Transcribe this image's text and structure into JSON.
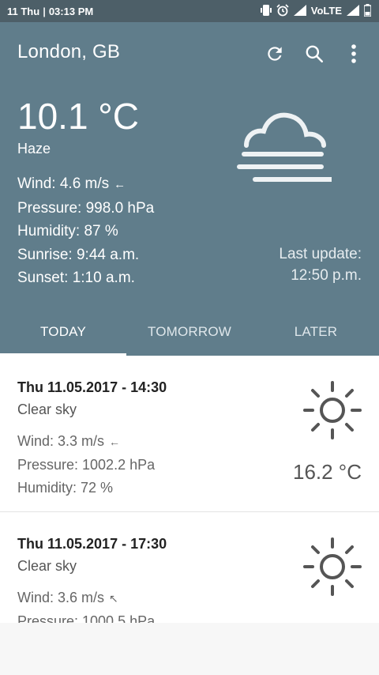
{
  "status_bar": {
    "date": "11 Thu",
    "time": "03:13 PM",
    "network": "VoLTE"
  },
  "header": {
    "city": "London, GB",
    "temperature": "10.1 °C",
    "description": "Haze",
    "wind": "Wind: 4.6 m/s",
    "wind_arrow": "←",
    "pressure": "Pressure: 998.0 hPa",
    "humidity": "Humidity: 87 %",
    "sunrise": "Sunrise: 9:44 a.m.",
    "sunset": "Sunset: 1:10 a.m.",
    "last_update_label": "Last update:",
    "last_update_time": "12:50 p.m.",
    "icons": [
      "refresh-icon",
      "search-icon",
      "more-vert-icon",
      "haze-icon"
    ]
  },
  "tabs": [
    "TODAY",
    "TOMORROW",
    "LATER"
  ],
  "forecast": [
    {
      "title": "Thu 11.05.2017 - 14:30",
      "description": "Clear sky",
      "wind": "Wind: 3.3 m/s",
      "wind_arrow": "←",
      "pressure": "Pressure: 1002.2 hPa",
      "humidity": "Humidity: 72 %",
      "temperature": "16.2 °C"
    },
    {
      "title": "Thu 11.05.2017 - 17:30",
      "description": "Clear sky",
      "wind": "Wind: 3.6 m/s",
      "wind_arrow": "↖",
      "pressure": "Pressure: 1000.5 hPa"
    }
  ]
}
